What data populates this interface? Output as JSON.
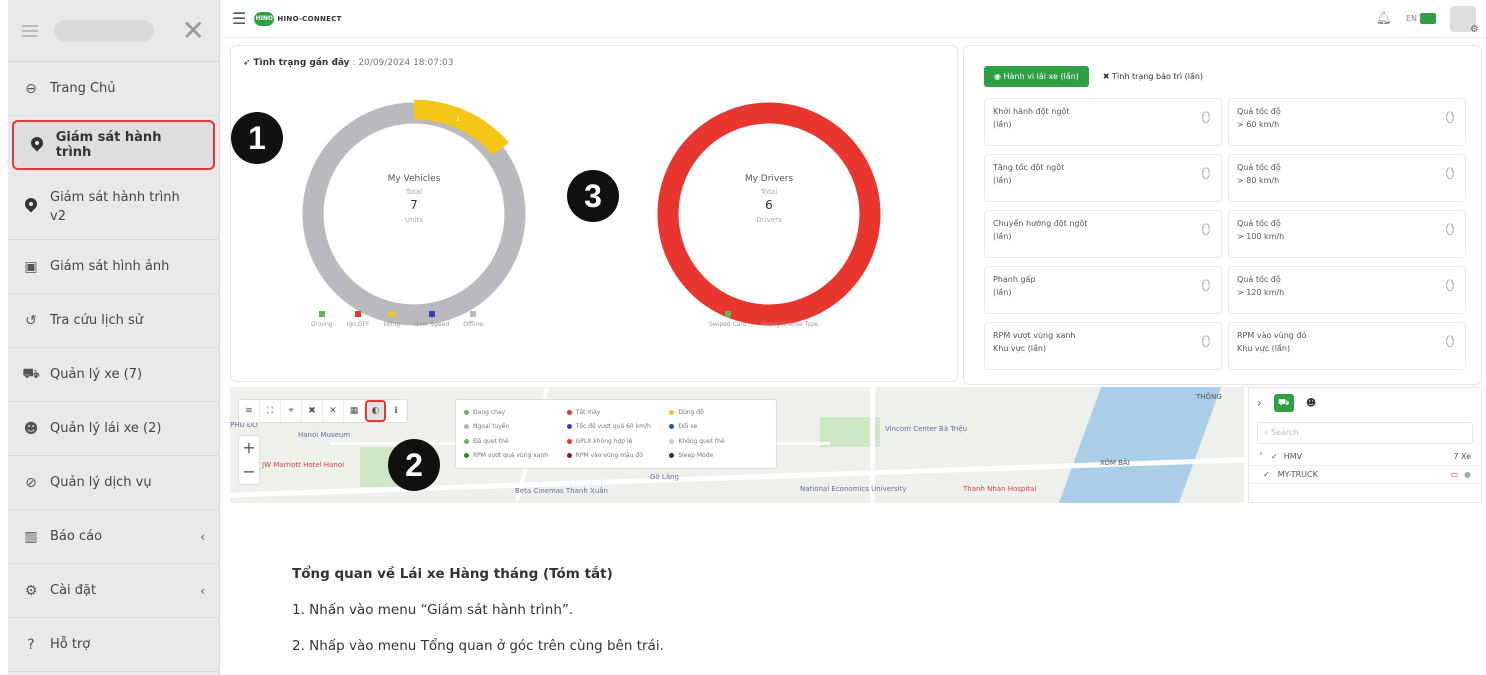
{
  "sidebar": {
    "items": [
      {
        "label": "Trang Chủ",
        "icon": "home-icon"
      },
      {
        "label": "Giám sát hành trình",
        "icon": "location-pin-icon"
      },
      {
        "label": "Giám sát hành trình v2",
        "icon": "location-pin-icon"
      },
      {
        "label": "Giám sát hình ảnh",
        "icon": "image-icon"
      },
      {
        "label": "Tra cứu lịch sử",
        "icon": "history-icon"
      },
      {
        "label": "Quản lý xe (7)",
        "icon": "car-icon"
      },
      {
        "label": "Quản lý lái xe (2)",
        "icon": "users-icon"
      },
      {
        "label": "Quản lý dịch vụ",
        "icon": "service-icon"
      },
      {
        "label": "Báo cáo",
        "icon": "chart-icon"
      },
      {
        "label": "Cài đặt",
        "icon": "settings-icon"
      },
      {
        "label": "Hỗ trợ",
        "icon": "help-icon"
      }
    ],
    "arrow": "‹"
  },
  "topbar": {
    "logo_badge": "HINO",
    "logo_text": "HINO-CONNECT",
    "flag_text": "EN"
  },
  "status": {
    "title": "Tình trạng gần đây",
    "timestamp": ": 20/09/2024 18:07:03",
    "vehicles": {
      "name": "My Vehicles",
      "total_label": "Total",
      "total": "7",
      "unit": "Units",
      "seg_gray": "6",
      "seg_yellow": "1"
    },
    "drivers": {
      "name": "My Drivers",
      "total_label": "Total",
      "total": "6",
      "unit": "Drivers",
      "seg_red": "6"
    },
    "veh_legend": [
      "Driving",
      "Ign.OFF",
      "Idling",
      "Over Speed",
      "Offline"
    ],
    "drv_legend": [
      "Swiped Card",
      "Wrong license Type"
    ],
    "colors": {
      "gray": "#b9b9be",
      "yellow": "#f5c518",
      "red": "#e8362f",
      "green": "#5cb85c",
      "blue": "#3d3db8"
    }
  },
  "behavior": {
    "tab_active": "Hành vi lái xe (lần)",
    "tab_other": "Tình trạng bảo trì (lần)",
    "tiles": [
      {
        "l1": "Khởi hành đột ngột",
        "l2": "(lần)",
        "v": "0"
      },
      {
        "l1": "Quá tốc độ",
        "l2": "> 60 km/h",
        "v": "0"
      },
      {
        "l1": "Tăng tốc đột ngột",
        "l2": "(lần)",
        "v": "0"
      },
      {
        "l1": "Quá tốc độ",
        "l2": "> 80 km/h",
        "v": "0"
      },
      {
        "l1": "Chuyển hướng đột ngột",
        "l2": "(lần)",
        "v": "0"
      },
      {
        "l1": "Quá tốc độ",
        "l2": "> 100 km/h",
        "v": "0"
      },
      {
        "l1": "Phanh gấp",
        "l2": "(lần)",
        "v": "0"
      },
      {
        "l1": "Quá tốc độ",
        "l2": "> 120 km/h",
        "v": "0"
      },
      {
        "l1": "RPM vượt vùng xanh",
        "l2": "Khu vực (lần)",
        "v": "0"
      },
      {
        "l1": "RPM vào vùng đỏ",
        "l2": "Khu vực (lần)",
        "v": "0"
      }
    ]
  },
  "map": {
    "legend": [
      {
        "label": "Đang chạy",
        "color": "#5cb85c"
      },
      {
        "label": "Tắt máy",
        "color": "#e8362f"
      },
      {
        "label": "Dừng đỗ",
        "color": "#f5c518"
      },
      {
        "label": "Ngoại tuyến",
        "color": "#b9b9be"
      },
      {
        "label": "Tốc độ vượt quá 60 km/h",
        "color": "#3d3db8"
      },
      {
        "label": "Đổi xe",
        "color": "#2255aa"
      },
      {
        "label": "Đã quẹt thẻ",
        "color": "#5cb85c"
      },
      {
        "label": "GPLX không hợp lệ",
        "color": "#e8362f"
      },
      {
        "label": "Không quẹt thẻ",
        "color": "#cccccc"
      },
      {
        "label": "RPM vượt quá vùng xanh",
        "color": "#2e7d32"
      },
      {
        "label": "RPM vào vùng màu đỏ",
        "color": "#6d2b2b"
      },
      {
        "label": "Sleep Mode",
        "color": "#333333"
      }
    ],
    "labels": [
      "Hanoi Museum",
      "JW Marriott Hotel Hanoi",
      "Vincom Center Bà Triệu",
      "Thanh Nhàn Hospital",
      "National Economics University",
      "Beta Cinemas Thanh Xuân",
      "XÓM BÃI",
      "THÔNG",
      "Gò Láng",
      "PHÚ ĐÔ"
    ]
  },
  "vehicles_panel": {
    "search_placeholder": "Search",
    "group": "HMV",
    "group_count": "7 Xe",
    "vehicle": "MY-TRUCK"
  },
  "callouts": [
    "1",
    "2",
    "3"
  ],
  "instructions": {
    "heading": "Tổng quan về Lái xe Hàng tháng (Tóm tắt)",
    "step1": "1. Nhấn vào menu “Giám sát hành trình”.",
    "step2": "2. Nhấp vào menu Tổng quan ở góc trên cùng bên trái."
  }
}
